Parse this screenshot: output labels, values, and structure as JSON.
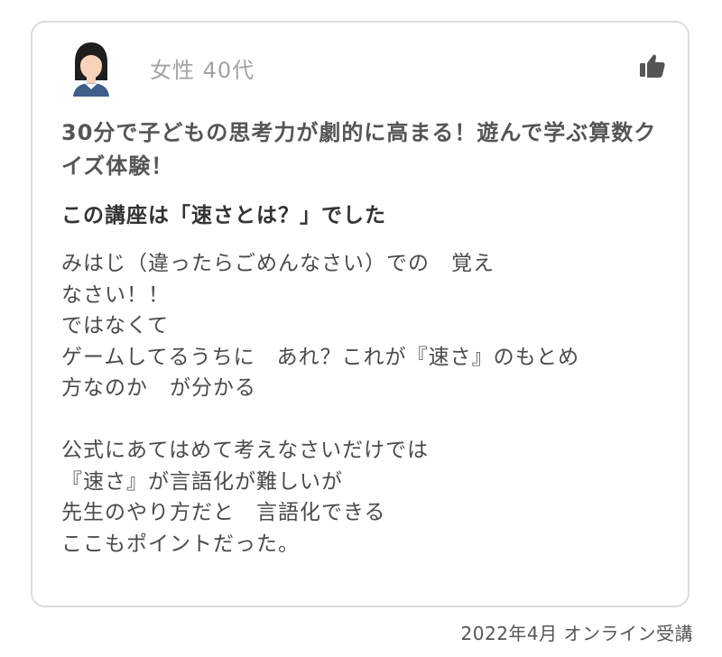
{
  "review": {
    "avatar_icon": "woman-avatar-icon",
    "user_label": "女性 40代",
    "like_icon": "thumbs-up-icon",
    "title": "30分で子どもの思考力が劇的に高まる！遊んで学ぶ算数クイズ体験！",
    "subtitle": "この講座は「速さとは？」でした",
    "body_lines": [
      "みはじ（違ったらごめんなさい）での　覚え",
      "なさい！！",
      "ではなくて",
      "ゲームしてるうちに　あれ？これが『速さ』のもとめ",
      "方なのか　が分かる",
      "",
      "公式にあてはめて考えなさいだけでは",
      "『速さ』が言語化が難しいが",
      "先生のやり方だと　言語化できる",
      "ここもポイントだった。"
    ]
  },
  "footer": {
    "meta": "2022年4月 オンライン受講"
  },
  "colors": {
    "card_border": "#dcdcdc",
    "muted_text": "#a3a3a3",
    "body_text": "#4a4a4a",
    "avatar_hair": "#1e1e1e",
    "avatar_skin": "#f6d3ba",
    "avatar_shirt": "#3f5e89"
  }
}
